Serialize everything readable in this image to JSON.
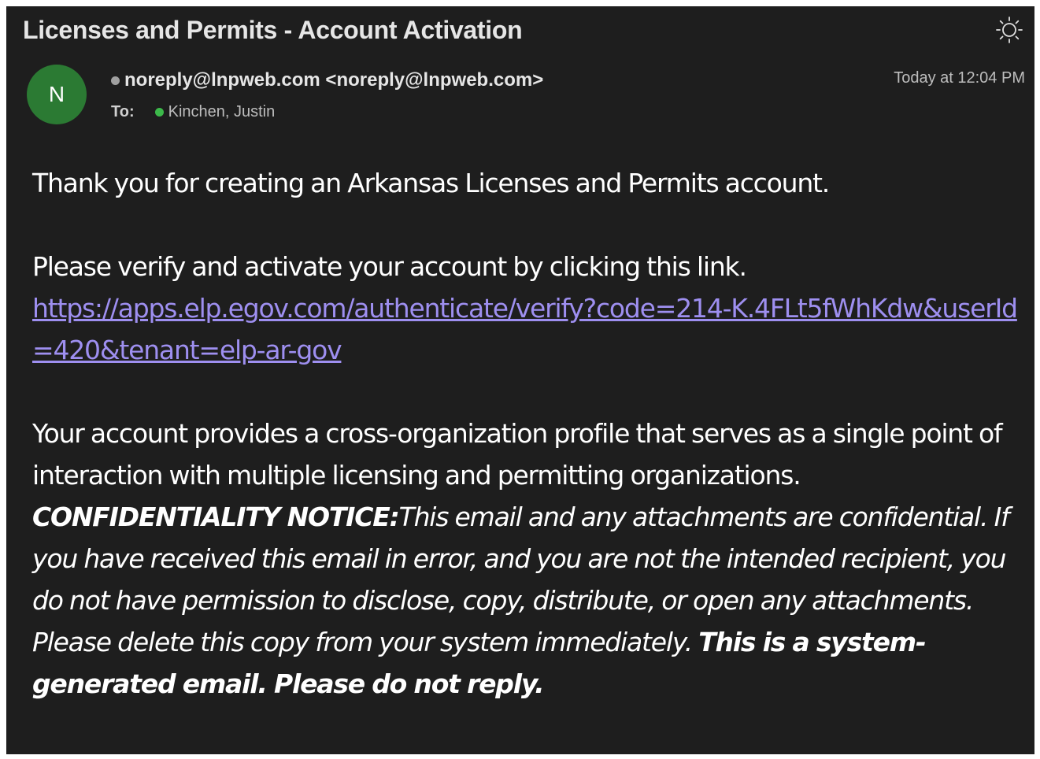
{
  "email": {
    "subject": "Licenses and Permits - Account Activation",
    "sender": {
      "avatar_initial": "N",
      "from": "noreply@lnpweb.com <noreply@lnpweb.com>",
      "to_label": "To:",
      "to": "Kinchen, Justin"
    },
    "timestamp": "Today at 12:04 PM",
    "icons": {
      "appearance_toggle": "brightness-icon"
    },
    "body": {
      "line1": "Thank you for creating an Arkansas Licenses and Permits account.",
      "line2": "Please verify and activate your account by clicking this link.",
      "link": "https://apps.elp.egov.com/authenticate/verify?code=214-K.4FLt5fWhKdw&userId=420&tenant=elp-ar-gov",
      "line3": "Your account provides a cross-organization profile that serves as a single point of interaction with multiple licensing and permitting organizations.",
      "notice_label": "CONFIDENTIALITY NOTICE:",
      "notice_text": "This email and any attachments are confidential. If you have received this email in error, and you are not the intended recipient, you do not have permission to disclose, copy, distribute, or open any attachments. Please delete this copy from your system immediately.",
      "notice_footer": "This is a system-generated email. Please do not reply."
    },
    "colors": {
      "background": "#1e1e1e",
      "link": "#9e8ff0",
      "avatar": "#2b7a33",
      "recipient_status": "#3cb94a"
    }
  }
}
